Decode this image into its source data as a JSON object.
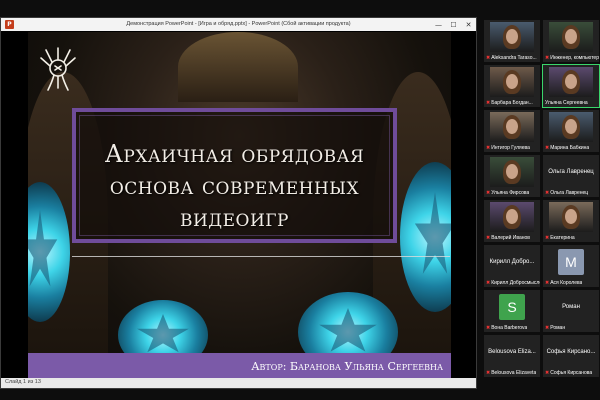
{
  "window": {
    "title": "Демонстрация PowerPoint - [Игра и обряд.pptx] - PowerPoint (Сбой активации продукта)",
    "app_icon": "P",
    "controls": {
      "minimize": "—",
      "maximize": "☐",
      "close": "✕"
    }
  },
  "slide": {
    "title": "Архаичная обрядовая\nоснова современных\nвидеоигр",
    "author": "Автор: Баранова Ульяна Сергеевна",
    "accent_color": "#7b5aa8"
  },
  "status_bar": {
    "text": "Слайд 1 из 13"
  },
  "participants": [
    {
      "name": "Aleksandra Taraso...",
      "kind": "video",
      "muted": true
    },
    {
      "name": "Инженер, компьютер",
      "kind": "video",
      "muted": true
    },
    {
      "name": "Барбара Богдан...",
      "kind": "video",
      "muted": true
    },
    {
      "name": "Ульяна Сергеевна",
      "kind": "video",
      "muted": false,
      "active": true
    },
    {
      "name": "Интигор Гуляева",
      "kind": "video",
      "muted": true
    },
    {
      "name": "Марина Бабкина",
      "kind": "video",
      "muted": true
    },
    {
      "name": "Ульяна Фирсова",
      "kind": "video",
      "muted": true
    },
    {
      "name": "Ольга Лавренец",
      "kind": "name",
      "center": "Ольга Лавренец",
      "muted": true
    },
    {
      "name": "Валерий Иванов",
      "kind": "video",
      "muted": true
    },
    {
      "name": "Екатерина",
      "kind": "video",
      "muted": true
    },
    {
      "name": "Кирилл Добросмыслов",
      "kind": "name",
      "center": "Кирилл Добро...",
      "muted": true
    },
    {
      "name": "Ася Королева",
      "kind": "avatar",
      "letter": "M",
      "color": "#8a98b0",
      "muted": true
    },
    {
      "name": "Вона Barberova",
      "kind": "avatar",
      "letter": "S",
      "color": "#3fa34d",
      "muted": true
    },
    {
      "name": "Роман",
      "kind": "name",
      "center": "Роман",
      "muted": true
    },
    {
      "name": "Belousova Elizaveta",
      "kind": "name",
      "center": "Belousova Eliza...",
      "muted": true
    },
    {
      "name": "Софья Кирсанова",
      "kind": "name",
      "center": "Софья Кирсано...",
      "muted": true
    }
  ]
}
